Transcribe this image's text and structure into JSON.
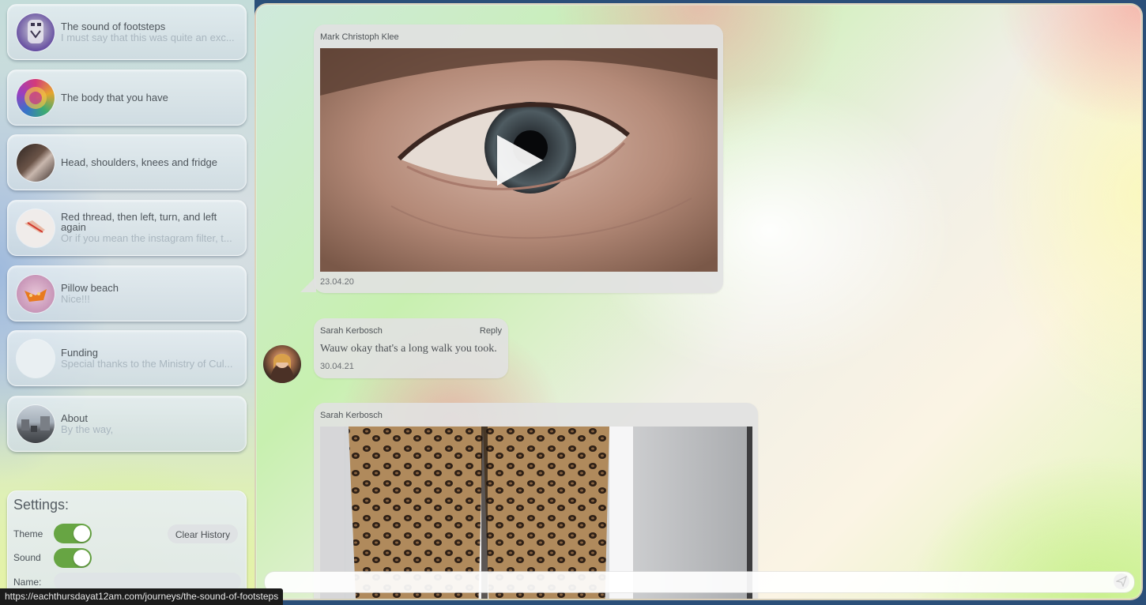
{
  "sidebar": {
    "items": [
      {
        "title": "The sound of footsteps",
        "subtitle": "I must say that this was quite an exc..."
      },
      {
        "title": "The body that you have",
        "subtitle": ""
      },
      {
        "title": "Head, shoulders, knees and fridge",
        "subtitle": ""
      },
      {
        "title": "Red thread, then left, turn, and left again",
        "subtitle": "Or if you mean the instagram filter, t..."
      },
      {
        "title": "Pillow beach",
        "subtitle": "Nice!!!"
      },
      {
        "title": "Funding",
        "subtitle": "Special thanks to the Ministry of Cul..."
      },
      {
        "title": "About",
        "subtitle": "By the way,"
      }
    ]
  },
  "settings": {
    "heading": "Settings:",
    "theme_label": "Theme",
    "sound_label": "Sound",
    "name_label": "Name:",
    "clear_history_label": "Clear History",
    "theme_on": true,
    "sound_on": true,
    "name_value": ""
  },
  "messages": [
    {
      "author": "Mark Christoph Klee",
      "date": "23.04.20",
      "type": "video"
    },
    {
      "author": "Sarah Kerbosch",
      "text": "Wauw okay that's a long walk you took.",
      "date": "30.04.21",
      "reply_label": "Reply",
      "type": "text"
    },
    {
      "author": "Sarah Kerbosch",
      "type": "video"
    }
  ],
  "composer": {
    "placeholder": ""
  },
  "status_bar": {
    "url": "https://eachthursdayat12am.com/journeys/the-sound-of-footsteps"
  },
  "colors": {
    "toggle_on": "#67a543",
    "status_bar_bg": "#1b1b1b"
  }
}
